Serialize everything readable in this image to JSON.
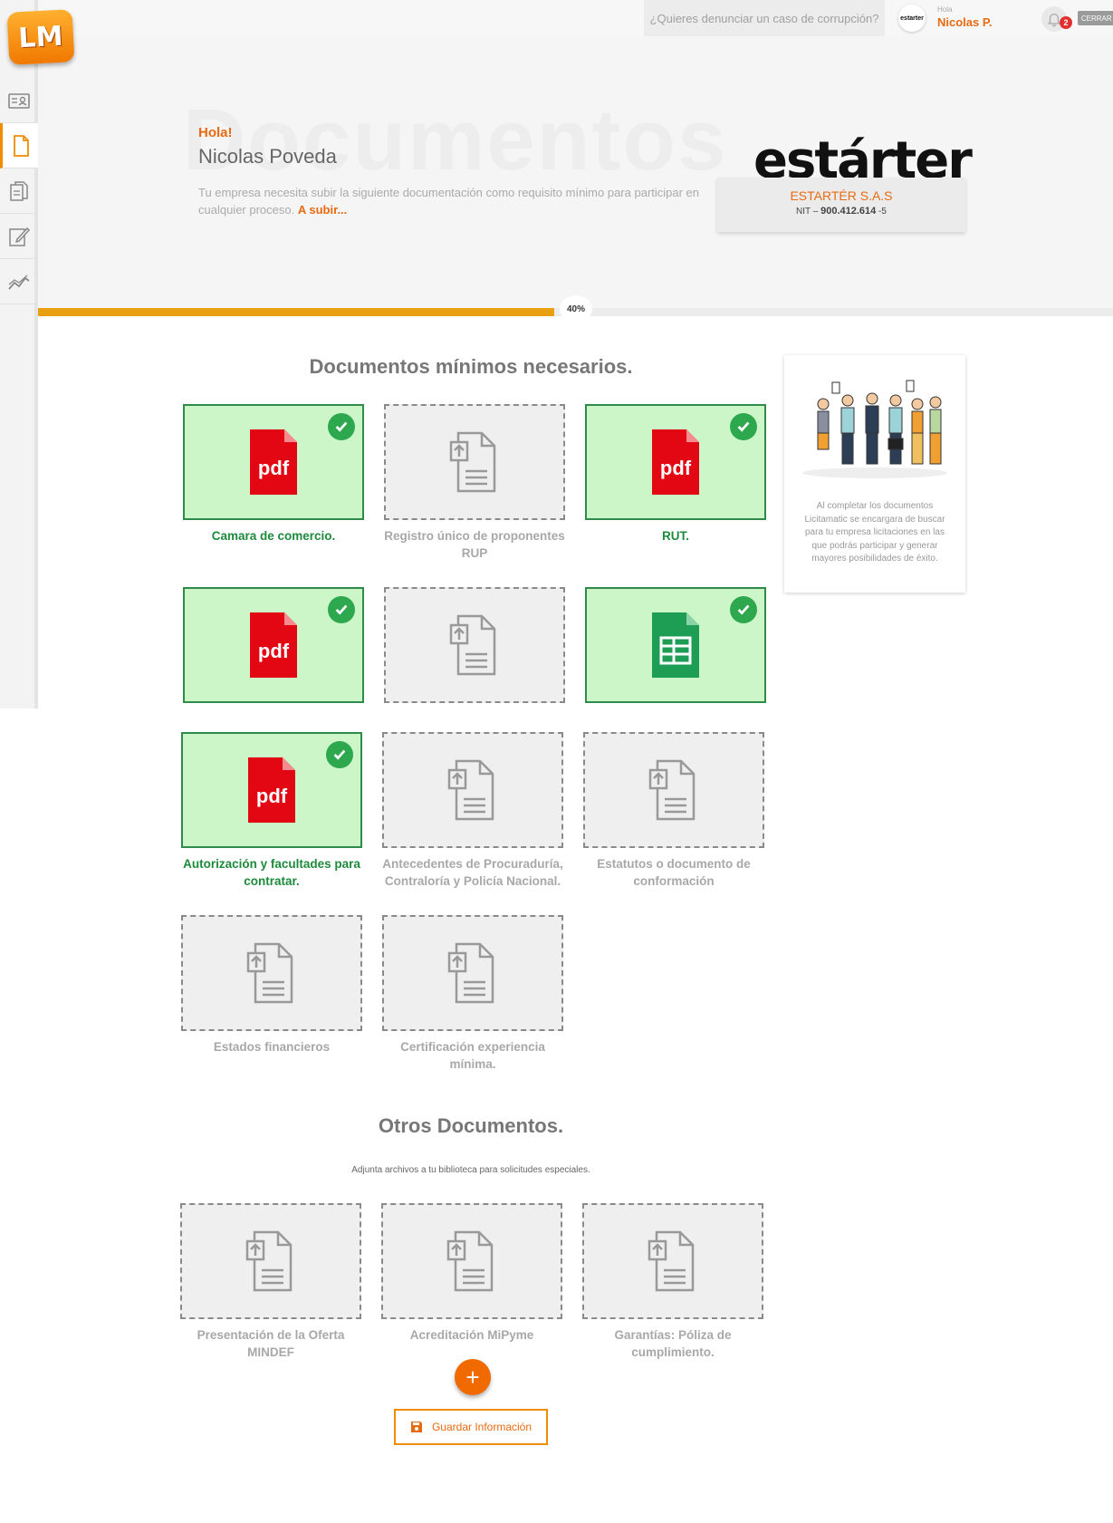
{
  "app": {
    "logo_text": "LM"
  },
  "sidebar": {
    "items": [
      {
        "name": "id-card-icon"
      },
      {
        "name": "document-icon",
        "active": true
      },
      {
        "name": "documents-icon"
      },
      {
        "name": "edit-icon"
      },
      {
        "name": "chart-icon"
      }
    ]
  },
  "topbar": {
    "report_link": "¿Quieres denunciar un caso de corrupción?",
    "company_mini_logo": "estarter",
    "greeting_small": "Hola",
    "user_short": "Nicolas P.",
    "notifications_count": "2",
    "logout_label": "CERRAR SESIÓN"
  },
  "hero": {
    "watermark": "Documentos",
    "hola": "Hola!",
    "full_name": "Nicolas Poveda",
    "description": "Tu empresa necesita subir la siguiente documentación como requisito mínimo para participar en cualquier proceso.",
    "more_link": "A subir...",
    "brand": "estárter",
    "company_name": "ESTARTÉR S.A.S",
    "nit_prefix": "NIT –",
    "nit_number": "900.412.614",
    "nit_suffix": "-5"
  },
  "progress": {
    "percent": 40,
    "label": "40%"
  },
  "sections": {
    "required_title": "Documentos mínimos necesarios.",
    "other_title": "Otros Documentos.",
    "other_subtitle": "Adjunta archivos a tu biblioteca para solicitudes especiales."
  },
  "required_docs": [
    {
      "label": "Camara de comercio.",
      "status": "done",
      "file": "pdf"
    },
    {
      "label": "Registro único de proponentes RUP",
      "status": "empty",
      "file": "upload"
    },
    {
      "label": "RUT.",
      "status": "done",
      "file": "pdf"
    },
    {
      "label": "",
      "status": "done",
      "file": "pdf"
    },
    {
      "label": "",
      "status": "empty",
      "file": "upload"
    },
    {
      "label": "",
      "status": "done",
      "file": "sheet"
    },
    {
      "label": "Autorización y facultades para contratar.",
      "status": "done",
      "file": "pdf"
    },
    {
      "label": "Antecedentes de Procuraduría, Contraloría y Policía Nacional.",
      "status": "empty",
      "file": "upload"
    },
    {
      "label": "Estatutos o documento de conformación",
      "status": "empty",
      "file": "upload"
    },
    {
      "label": "Estados financieros",
      "status": "empty",
      "file": "upload"
    },
    {
      "label": "Certificación experiencia mínima.",
      "status": "empty",
      "file": "upload"
    }
  ],
  "other_docs": [
    {
      "label": "Presentación de la Oferta MINDEF",
      "status": "empty",
      "file": "upload"
    },
    {
      "label": "Acreditación MiPyme",
      "status": "empty",
      "file": "upload"
    },
    {
      "label": "Garantías: Póliza de cumplimiento.",
      "status": "empty",
      "file": "upload"
    }
  ],
  "side_card": {
    "text": "Al completar los documentos Licitamatic se encargara de buscar para tu empresa licitaciones en las que podrás participar y generar mayores posibilidades de éxito."
  },
  "actions": {
    "add_label": "+",
    "save_label": "Guardar Información"
  },
  "colors": {
    "accent": "#e86a10",
    "done_bg": "#ccf5c8",
    "done_border": "#2e8b4a",
    "pdf_red": "#e30613",
    "sheet_green": "#1e9e55"
  }
}
